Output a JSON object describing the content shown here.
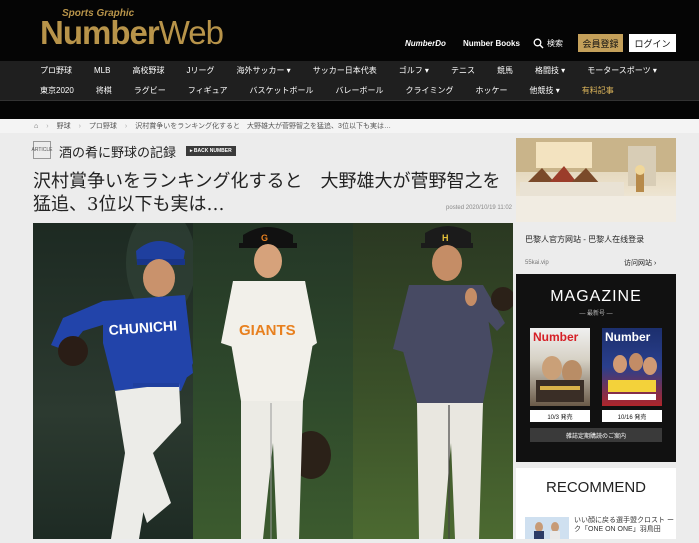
{
  "header": {
    "logo_small": "Sports Graphic",
    "logo_main": "Number",
    "logo_web": "Web",
    "links": [
      "NumberDo",
      "Number Books"
    ],
    "search_label": "検索",
    "register_label": "会員登録",
    "login_label": "ログイン"
  },
  "nav_row1": [
    "プロ野球",
    "MLB",
    "高校野球",
    "Jリーグ",
    "海外サッカー ▾",
    "サッカー日本代表",
    "ゴルフ ▾",
    "テニス",
    "競馬",
    "格闘技 ▾",
    "モータースポーツ ▾"
  ],
  "nav_row2": [
    "東京2020",
    "将棋",
    "ラグビー",
    "フィギュア",
    "バスケットボール",
    "バレーボール",
    "クライミング",
    "ホッケー",
    "他競技 ▾",
    "有料記事"
  ],
  "breadcrumb": [
    "⌂",
    "野球",
    "プロ野球",
    "沢村賞争いをランキング化すると　大野雄大が菅野智之を猛追、3位以下も実は…"
  ],
  "article": {
    "badge": "ARTICLE",
    "series": "酒の肴に野球の記録",
    "back_number": "▸ BACK NUMBER",
    "title": "沢村賞争いをランキング化すると　大野雄大が菅野智之を猛追、3位以下も実は…",
    "posted": "posted 2020/10/19 11:02"
  },
  "photo_text": {
    "dragons_jersey": "CHUNICHI",
    "giants_jersey": "GIANTS",
    "giants_cap": "G",
    "tigers_cap": "H"
  },
  "sidebar": {
    "ad_title": "巴黎人官方网站 - 巴黎人在线登录",
    "ad_url": "55kai.vip",
    "ad_visit": "访问网站 ›",
    "magazine_title": "MAGAZINE",
    "magazine_sub": "— 最新号 —",
    "cover1_logo": "Number",
    "cover2_logo": "Number",
    "issue1": "10/3 発売",
    "issue2": "10/16 発売",
    "subscribe": "雑誌定期購読のご案内",
    "recommend_title": "RECOMMEND",
    "recommend_text": "いい顔に戻る選手盟クロスト ーク「ONE ON ONE」羽鳥田"
  },
  "colors": {
    "header_bg": "#050505",
    "gold": "#b8944a",
    "dragons_blue": "#1f3f9e",
    "giants_orange": "#e8801f",
    "tigers_gray": "#474a63"
  }
}
